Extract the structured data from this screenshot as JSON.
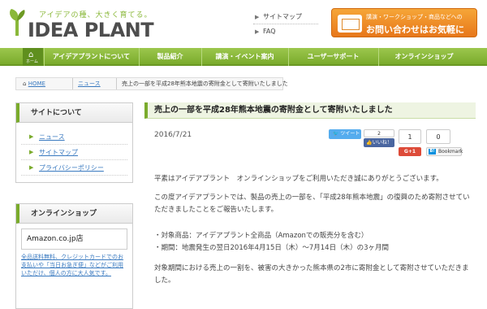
{
  "header": {
    "tagline": "アイデアの種、大きく育てる。",
    "logo_main": "IDEA",
    "logo_sub": "PLANT",
    "toplinks": [
      "サイトマップ",
      "FAQ"
    ],
    "contact_small": "講演・ワークショップ・商品などへの",
    "contact_big": "お問い合わせはお気軽に"
  },
  "nav": {
    "home_label": "ホーム",
    "items": [
      "アイデアプラントについて",
      "製品紹介",
      "講演・イベント案内",
      "ユーザーサポート",
      "オンラインショップ"
    ]
  },
  "breadcrumb": {
    "home": "HOME",
    "news": "ニュース",
    "current": "売上の一部を平成28年熊本地震の寄附金として寄附いたしました"
  },
  "sidebar": {
    "about_title": "サイトについて",
    "about_items": [
      "ニュース",
      "サイトマップ",
      "プライバシーポリシー"
    ],
    "shop_title": "オンラインショップ",
    "amazon_label": "Amazon.co.jp店",
    "amazon_text": "全品送料無料、クレジットカードでのお支払いや「当日お急ぎ便」などがご利用いただけ、個人の方に大人気です。"
  },
  "post": {
    "title": "売上の一部を平成28年熊本地震の寄附金として寄附いたしました",
    "date": "2016/7/21",
    "share": {
      "tweet": "ツイート",
      "fb_count": "2",
      "fb_like": "いいね！",
      "g_count": "1",
      "g_label": "G+1",
      "h_count": "0",
      "h_label": "Bookmark"
    },
    "paragraphs": [
      "平素はアイデアプラント　オンラインショップをご利用いただき誠にありがとうございます。",
      "この度アイデアプラントでは、製品の売上の一部を、「平成28年熊本地震」の復興のため寄附させていただきましたことをご報告いたします。",
      "・対象商品：アイデアプラント全商品（Amazonでの販売分を含む）",
      "・期間：地震発生の翌日2016年4月15日（木）〜7月14日（木）の3ヶ月間",
      "対象期間における売上の一割を、被害の大きかった熊本県の2市に寄附金として寄附させていただきました。"
    ]
  }
}
